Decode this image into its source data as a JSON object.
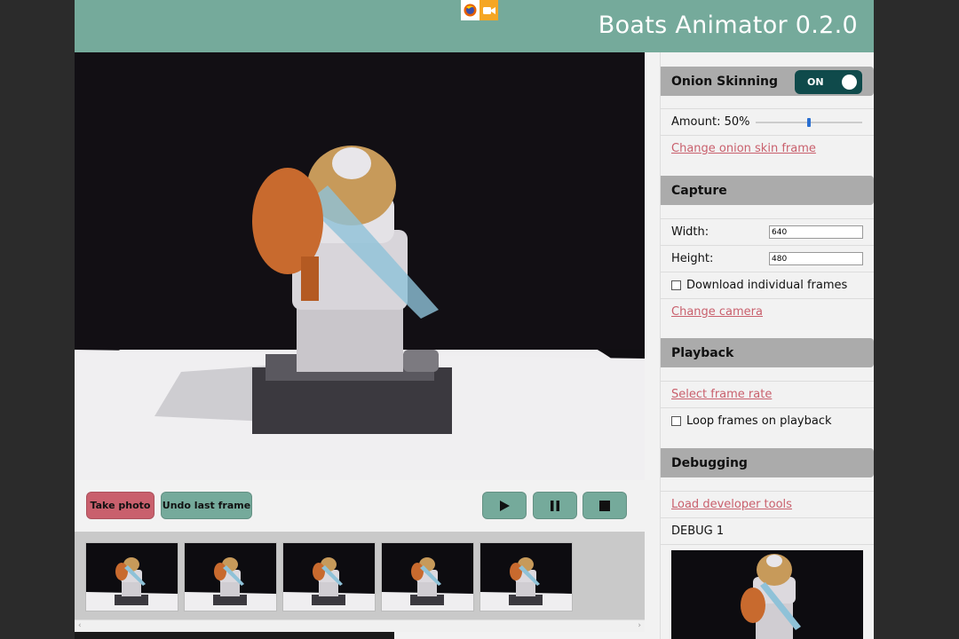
{
  "header": {
    "title": "Boats Animator 0.2.0",
    "icons": [
      "firefox-icon",
      "camera-icon"
    ]
  },
  "controls": {
    "take_photo": "Take photo",
    "undo_last_frame": "Undo last frame",
    "play_icon": "play-icon",
    "pause_icon": "pause-icon",
    "stop_icon": "stop-icon"
  },
  "timeline": {
    "frame_count": 5
  },
  "sidebar": {
    "onion": {
      "title": "Onion Skinning",
      "toggle_label": "ON",
      "amount_label": "Amount: 50%",
      "amount_value": 0.5,
      "change_frame": "Change onion skin frame"
    },
    "capture": {
      "title": "Capture",
      "width_label": "Width:",
      "width_value": "640",
      "height_label": "Height:",
      "height_value": "480",
      "download_label": "Download individual frames",
      "change_camera": "Change camera"
    },
    "playback": {
      "title": "Playback",
      "frame_rate": "Select frame rate",
      "loop_label": "Loop frames on playback"
    },
    "debugging": {
      "title": "Debugging",
      "dev_tools": "Load developer tools",
      "debug_text": "DEBUG 1"
    }
  },
  "colors": {
    "header": "#75aa9b",
    "take_photo": "#c9606d",
    "accent": "#75aa9b",
    "toggle": "#0f4a4b",
    "link": "#c9606d"
  }
}
